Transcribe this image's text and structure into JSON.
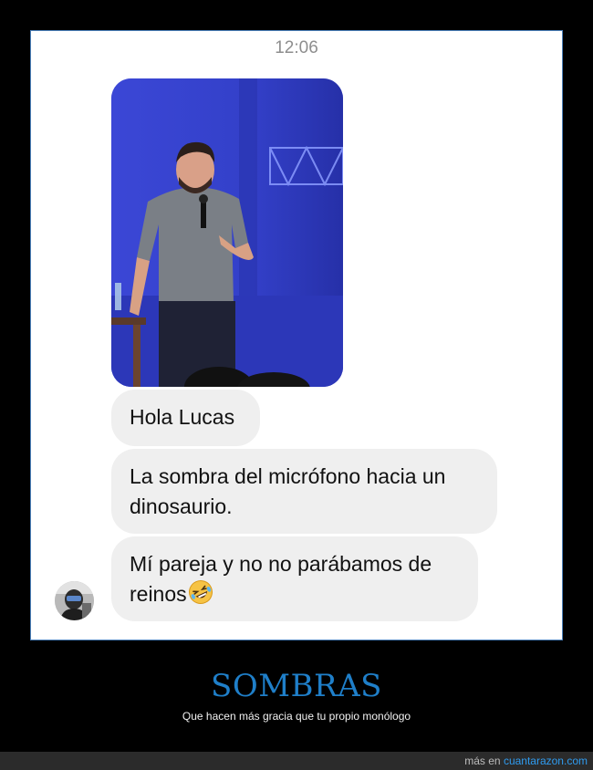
{
  "chat": {
    "timestamp": "12:06",
    "messages": [
      {
        "lines": [
          "Hola Lucas"
        ]
      },
      {
        "lines": [
          "La sombra del micrófono hacia un",
          "dinosaurio."
        ]
      },
      {
        "lines": [
          "Mí pareja y no no parábamos de",
          "reinos"
        ],
        "emoji": "rolling-on-floor-laughing-emoji"
      }
    ]
  },
  "caption": {
    "title": "SOMBRAS",
    "subtitle": "Que hacen más gracia que tu propio monólogo"
  },
  "footer": {
    "prefix": "más en ",
    "site": "cuantarazon.com"
  },
  "colors": {
    "background": "#000000",
    "title": "#1f7fc9",
    "bubble": "#efefef",
    "link": "#2f9bef"
  }
}
